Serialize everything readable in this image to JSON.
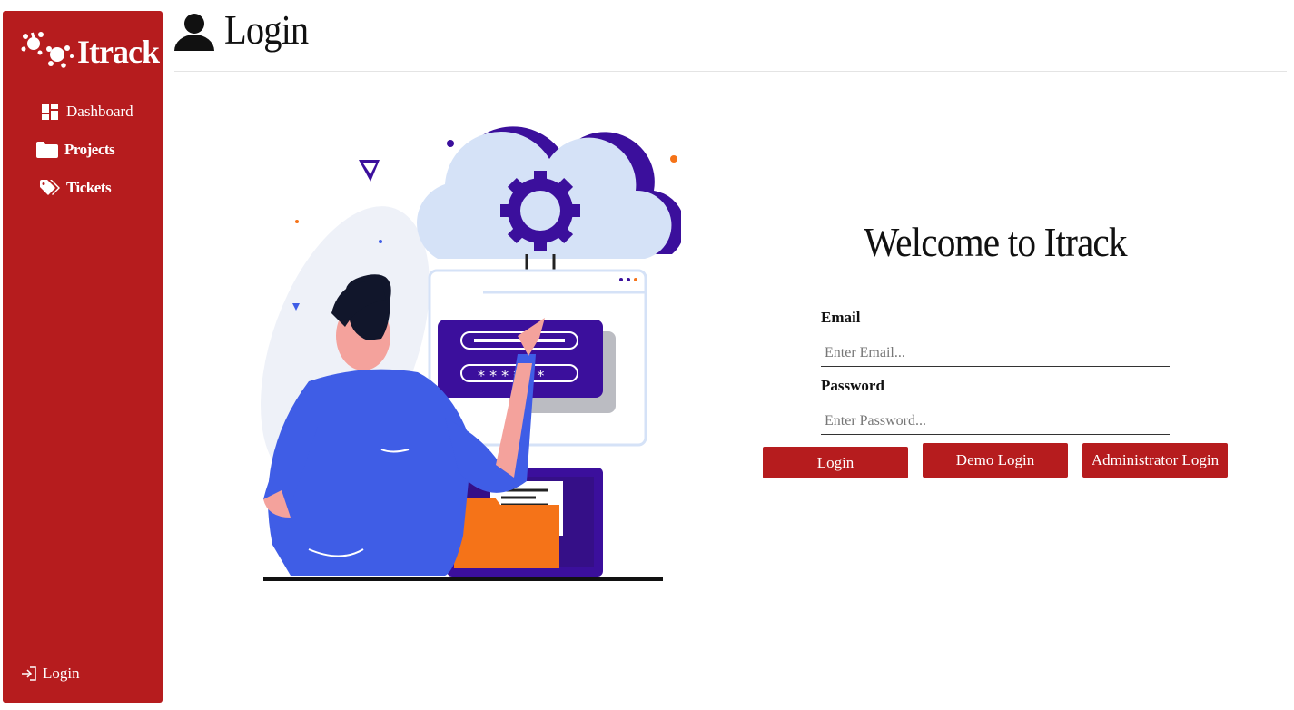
{
  "app": {
    "name": "Itrack"
  },
  "sidebar": {
    "items": [
      {
        "label": "Dashboard",
        "icon": "dashboard-icon"
      },
      {
        "label": "Projects",
        "icon": "folder-icon"
      },
      {
        "label": "Tickets",
        "icon": "tags-icon"
      }
    ],
    "login_label": "Login"
  },
  "header": {
    "title": "Login"
  },
  "main": {
    "welcome": "Welcome to Itrack",
    "email": {
      "label": "Email",
      "placeholder": "Enter Email...",
      "value": ""
    },
    "password": {
      "label": "Password",
      "placeholder": "Enter Password...",
      "value": ""
    },
    "buttons": {
      "login": "Login",
      "demo": "Demo Login",
      "admin": "Administrator Login"
    }
  },
  "colors": {
    "accent": "#b61c1e",
    "illustration_purple": "#3b0f9c",
    "illustration_blue": "#3f5de6",
    "illustration_orange": "#f57318"
  }
}
